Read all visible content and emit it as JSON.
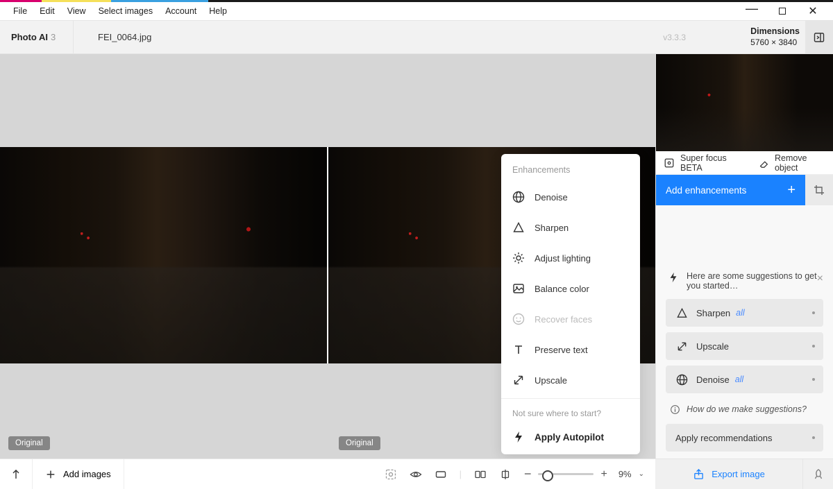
{
  "menu": {
    "items": [
      "File",
      "Edit",
      "View",
      "Select images",
      "Account",
      "Help"
    ]
  },
  "app": {
    "name": "Photo AI",
    "count": "3",
    "filename": "FEI_0064.jpg",
    "version": "v3.3.3",
    "dim_label": "Dimensions",
    "dim_value": "5760 × 3840"
  },
  "original_tag": "Original",
  "enh_menu": {
    "heading": "Enhancements",
    "items": [
      {
        "label": "Denoise",
        "disabled": false,
        "icon": "globe-icon"
      },
      {
        "label": "Sharpen",
        "disabled": false,
        "icon": "triangle-icon"
      },
      {
        "label": "Adjust lighting",
        "disabled": false,
        "icon": "brightness-icon"
      },
      {
        "label": "Balance color",
        "disabled": false,
        "icon": "image-icon"
      },
      {
        "label": "Recover faces",
        "disabled": true,
        "icon": "face-icon"
      },
      {
        "label": "Preserve text",
        "disabled": false,
        "icon": "text-icon"
      },
      {
        "label": "Upscale",
        "disabled": false,
        "icon": "expand-icon"
      }
    ],
    "footer_hint": "Not sure where to start?",
    "apply_label": "Apply Autopilot"
  },
  "quick_actions": {
    "focus": "Super focus BETA",
    "remove": "Remove object"
  },
  "add_enh": "Add enhancements",
  "suggestions": {
    "heading": "Here are some suggestions to get you started…",
    "items": [
      {
        "label": "Sharpen",
        "tag": "all",
        "icon": "triangle-icon"
      },
      {
        "label": "Upscale",
        "tag": "",
        "icon": "expand-icon"
      },
      {
        "label": "Denoise",
        "tag": "all",
        "icon": "globe-icon"
      }
    ],
    "how": "How do we make suggestions?",
    "apply": "Apply recommendations"
  },
  "footer": {
    "add_images": "Add images",
    "zoom": "9%",
    "export": "Export image"
  }
}
